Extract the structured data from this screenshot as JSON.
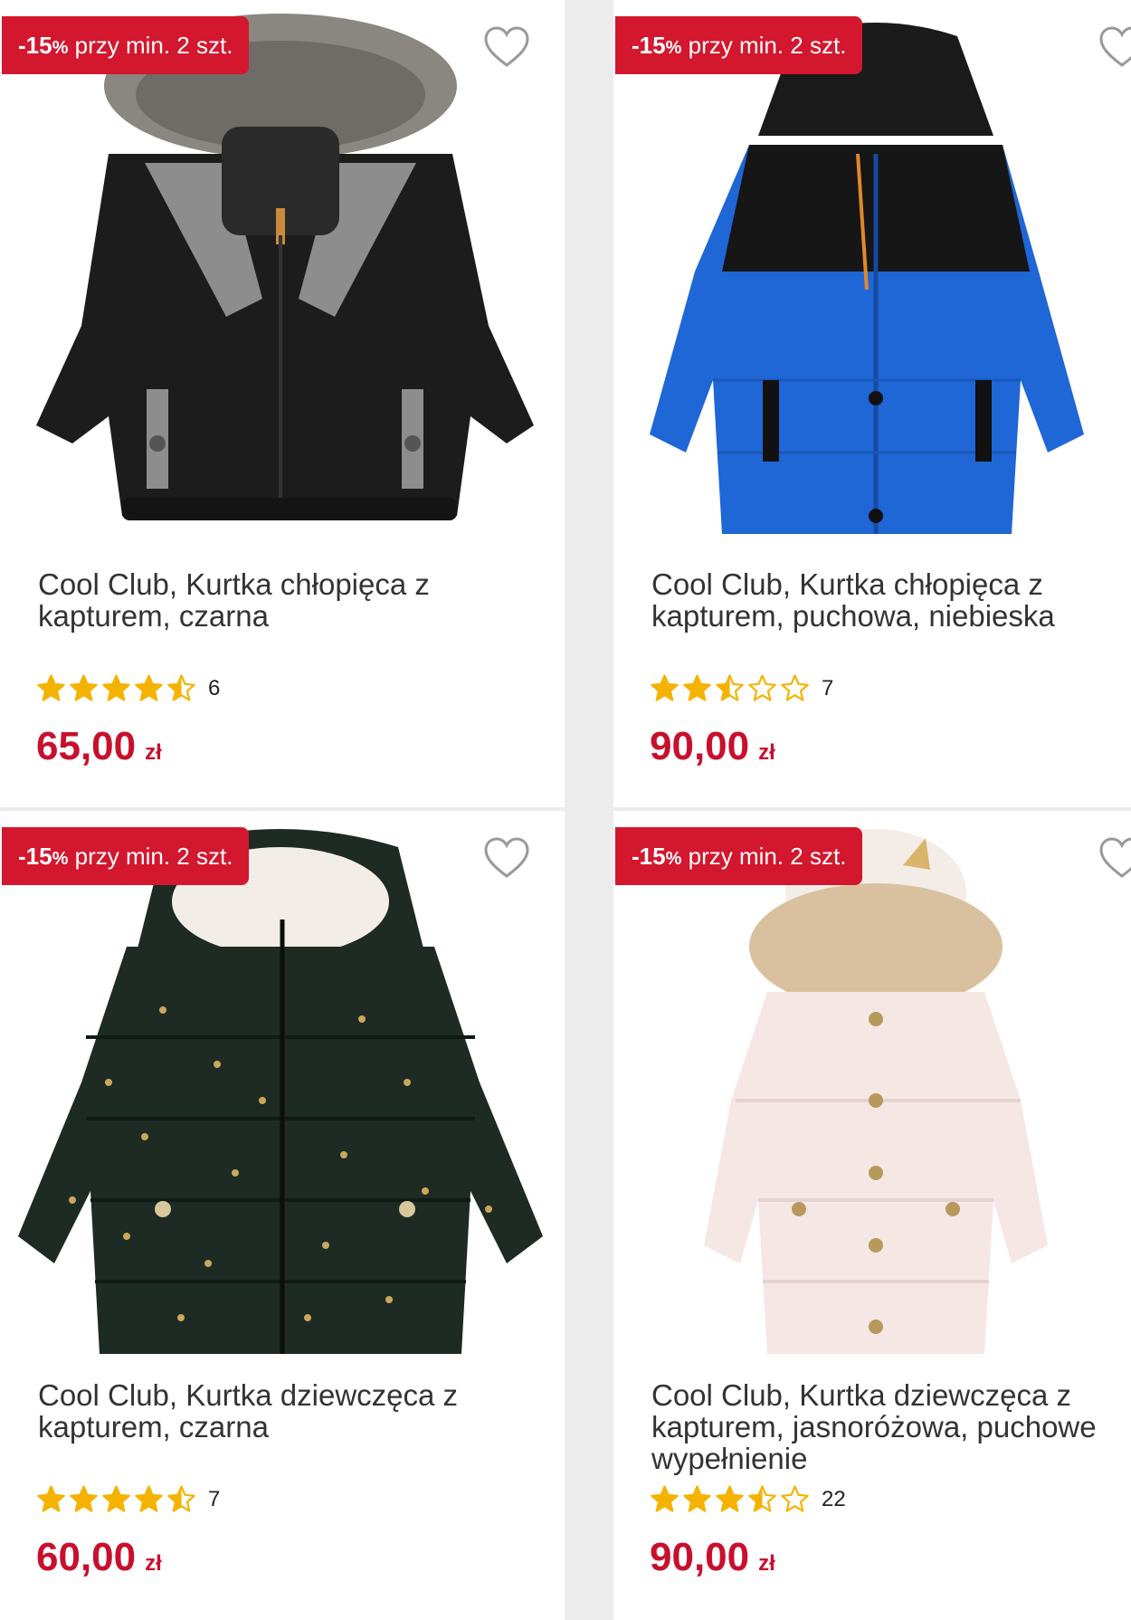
{
  "badge": {
    "discount": "-15",
    "pct": "%",
    "rest": "przy min. 2 szt."
  },
  "colors": {
    "accent": "#d3172e",
    "price": "#c8102e",
    "star": "#f5b301"
  },
  "products": [
    {
      "title": "Cool Club, Kurtka chłopięca z kapturem, czarna",
      "rating": 4.5,
      "reviews": "6",
      "price": "65,00",
      "currency": "zł"
    },
    {
      "title": "Cool Club, Kurtka chłopięca z kapturem, puchowa, niebieska",
      "rating": 2.5,
      "reviews": "7",
      "price": "90,00",
      "currency": "zł"
    },
    {
      "title": "Cool Club, Kurtka dziewczęca z kapturem, czarna",
      "rating": 4.5,
      "reviews": "7",
      "price": "60,00",
      "currency": "zł"
    },
    {
      "title": "Cool Club, Kurtka dziewczęca z kapturem, jasnoróżowa, puchowe wypełnienie",
      "rating": 3.5,
      "reviews": "22",
      "price": "90,00",
      "currency": "zł"
    }
  ]
}
